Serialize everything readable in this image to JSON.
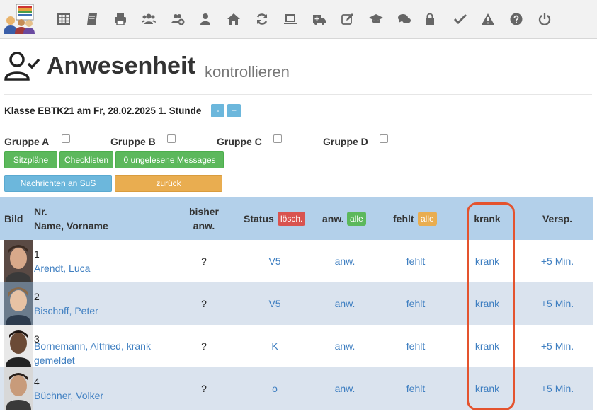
{
  "toolbar": {
    "icons": [
      "table-icon",
      "book-icon",
      "print-icon",
      "users-icon",
      "user-plus-icon",
      "user-icon",
      "home-icon",
      "refresh-icon",
      "laptop-icon",
      "ambulance-icon",
      "edit-icon",
      "graduation-cap-icon",
      "comments-icon",
      "lock-icon",
      "check-icon",
      "warning-icon",
      "help-icon",
      "power-icon"
    ]
  },
  "header": {
    "title": "Anwesenheit",
    "subtitle": "kontrollieren"
  },
  "klasse": {
    "label": "Klasse EBTK21 am Fr, 28.02.2025 1. Stunde",
    "minus": "-",
    "plus": "+"
  },
  "gruppen": [
    "Gruppe A",
    "Gruppe B",
    "Gruppe C",
    "Gruppe D"
  ],
  "buttons": {
    "sitzplaene": "Sitzpläne",
    "checklisten": "Checklisten",
    "messages": "0 ungelesene Messages",
    "nachrichten": "Nachrichten an SuS",
    "zurueck": "zurück"
  },
  "table": {
    "headers": {
      "bild": "Bild",
      "nr": "Nr.",
      "name": "Name, Vorname",
      "bisher1": "bisher",
      "bisher2": "anw.",
      "status": "Status",
      "status_badge": "lösch.",
      "anw": "anw.",
      "anw_badge": "alle",
      "fehlt": "fehlt",
      "fehlt_badge": "alle",
      "krank": "krank",
      "versp": "Versp."
    },
    "rows": [
      {
        "nr": "1",
        "name1": "Arendt, Luca",
        "name2": "",
        "bisher": "?",
        "status": "V5",
        "anw": "anw.",
        "fehlt": "fehlt",
        "krank": "krank",
        "versp": "+5 Min."
      },
      {
        "nr": "2",
        "name1": "Bischoff, Peter",
        "name2": "",
        "bisher": "?",
        "status": "V5",
        "anw": "anw.",
        "fehlt": "fehlt",
        "krank": "krank",
        "versp": "+5 Min."
      },
      {
        "nr": "3",
        "name1": "Bornemann, Altfried, krank",
        "name2": "gemeldet",
        "bisher": "?",
        "status": "K",
        "anw": "anw.",
        "fehlt": "fehlt",
        "krank": "krank",
        "versp": "+5 Min."
      },
      {
        "nr": "4",
        "name1": "Büchner, Volker",
        "name2": "",
        "bisher": "?",
        "status": "o",
        "anw": "anw.",
        "fehlt": "fehlt",
        "krank": "krank",
        "versp": "+5 Min."
      }
    ]
  },
  "colors": {
    "accent": "#3f7fc1",
    "header_bg": "#b3d0ea",
    "alt_row": "#dae3ee",
    "highlight": "#e4532e"
  }
}
